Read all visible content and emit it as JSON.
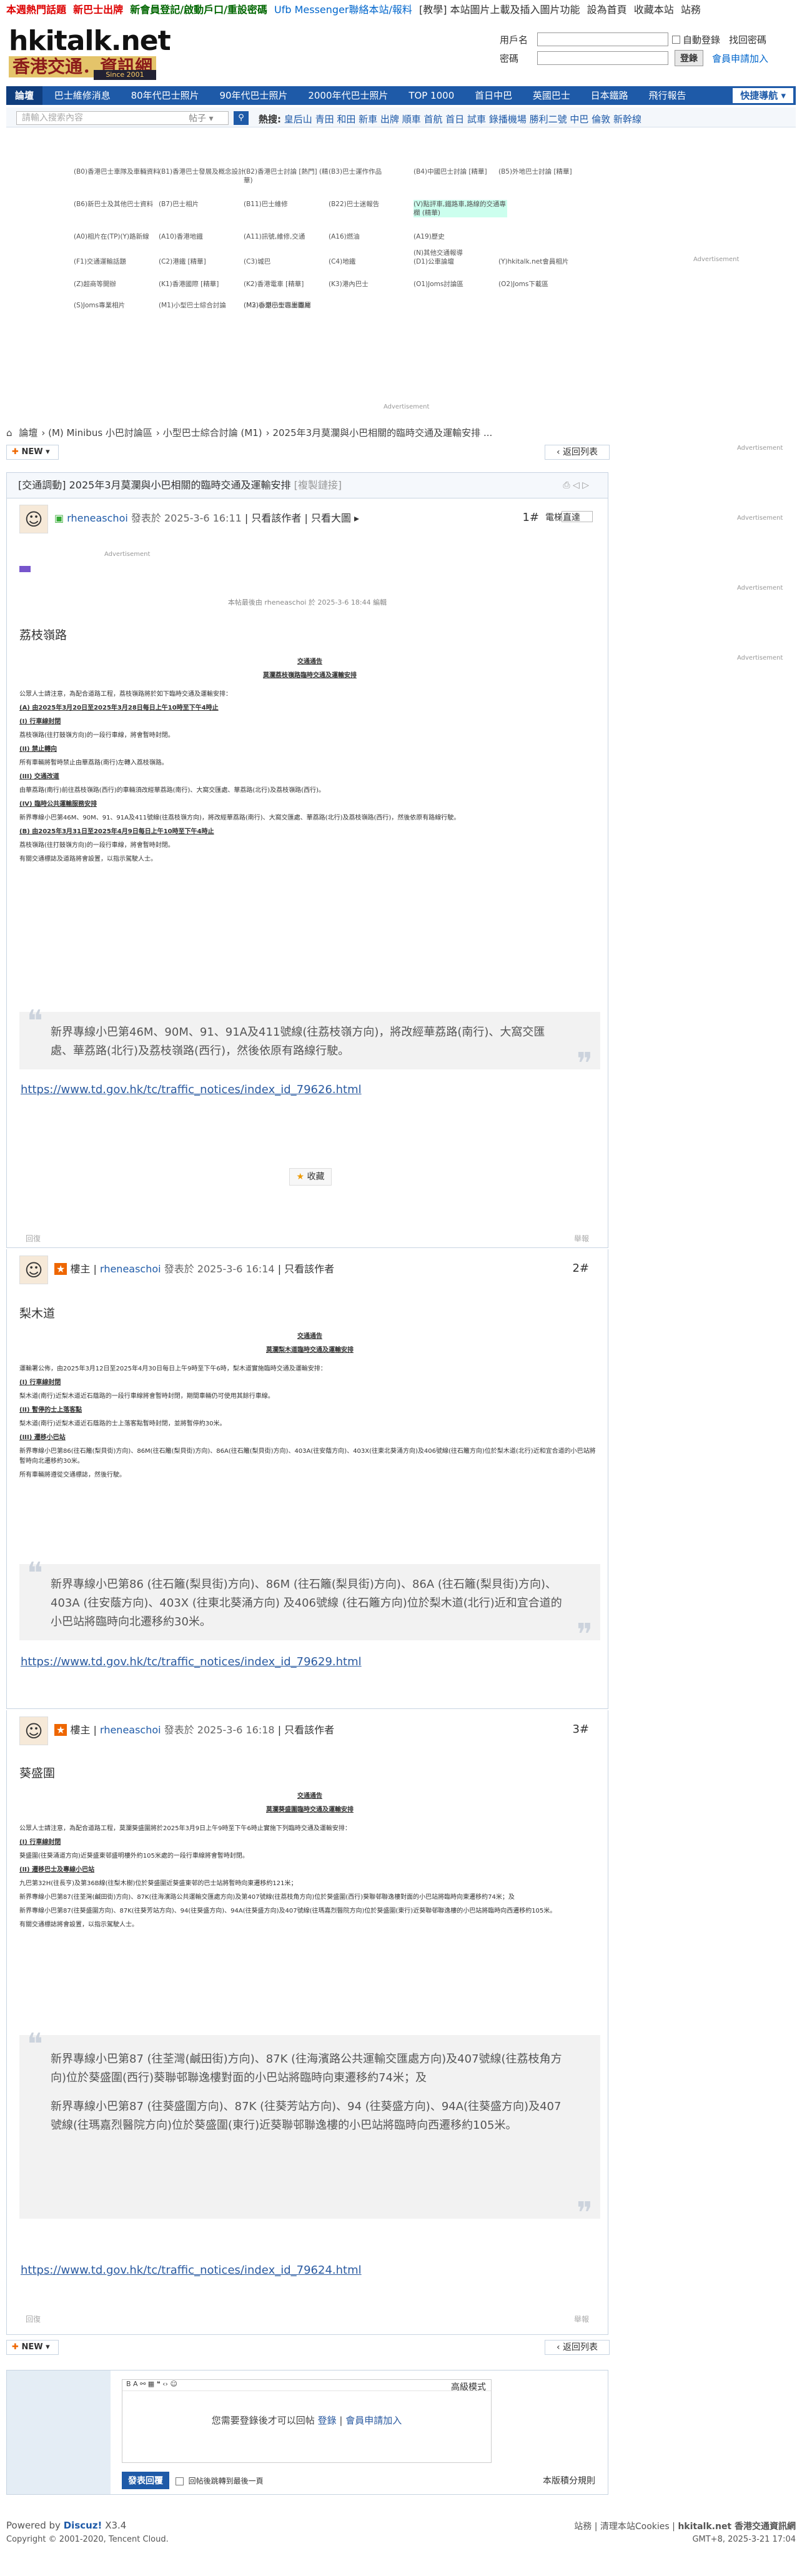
{
  "top_links": {
    "hot": "本週熱門話題",
    "new_members": "新巴士出牌",
    "signup": "新會員登記/啟動戶口/重設密碼",
    "messenger": "Ufb Messenger聯絡本站/報料",
    "teach": "[教學] 本站圖片上載及插入圖片功能",
    "home": "設為首頁",
    "fav": "收藏本站",
    "site": "站務"
  },
  "logo": {
    "site": "hkitalk.net",
    "name": "香港交通．資訊網",
    "since": "Since 2001"
  },
  "login": {
    "user_label": "用戶名",
    "pass_label": "密碼",
    "auto_login": "自動登錄",
    "forgot": "找回密碼",
    "login_btn": "登錄",
    "register": "會員申請加入"
  },
  "nav": {
    "items": [
      "論壇",
      "巴士維修消息",
      "80年代巴士照片",
      "90年代巴士照片",
      "2000年代巴士照片",
      "TOP 1000",
      "首日中巴",
      "英國巴士",
      "日本鐵路",
      "飛行報告"
    ],
    "quick": "快捷導航"
  },
  "search": {
    "placeholder": "請輸入搜索內容",
    "type": "帖子",
    "hot_label": "熱搜:",
    "hot": [
      "皇后山",
      "青田",
      "和田",
      "新車",
      "出牌",
      "順車",
      "首航",
      "首日",
      "試車",
      "錄播機場",
      "勝利二號",
      "中巴",
      "倫敦",
      "新幹線"
    ]
  },
  "forums": [
    "(B0)香港巴士車隊及車輛資料",
    "(B1)香港巴士發展及概念設計",
    "(B2)香港巴士討論 [熱門] (精華)",
    "(B3)巴士運作作品",
    "(B4)中國巴士討論 [精華]",
    "(B5)外地巴士討論 [精華]",
    "(B6)新巴士及其他巴士資料",
    "(B7)巴士相片",
    "(B11)巴士維修",
    "(B22)巴士迷報告",
    "(V)點評車,鐵路車,路線的交通專欄 (精華)",
    "(A0)相片在(TP)(Y)路新線",
    "(A10)香港地鐵",
    "(A11)訊號,維修,交通",
    "(A16)燃油",
    "(A19)歷史",
    "(N)其他交通報導",
    "(F1)交通運輸話題",
    "(C2)港鐵 [精華]",
    "(C3)城巴",
    "(C4)地鐵",
    "(D1)公車論壇",
    "(Y)hkitalk.net會員相片",
    "(Z)超商等開辦",
    "(K1)香港國際 [精華]",
    "(K2)香港電車 [精華]",
    "(K3)港內巴士",
    "(O1)Joms討論區",
    "(O2)Joms下載區",
    "(S)Joms專業相片",
    "(M1)小型巴士綜合討論",
    "(M2)小型巴士專屬圖片",
    "(M3)香港小型巴士專屬"
  ],
  "ad_label": "Advertisement",
  "breadcrumb": [
    "論壇",
    "(M) Minibus 小巴討論區",
    "小型巴士綜合討論 (M1)",
    "2025年3月莫瀾與小巴相關的臨時交通及運輸安排 ..."
  ],
  "new_btn": "NEW",
  "back_btn": "返回列表",
  "thread": {
    "tag": "[交通調動]",
    "title": "2025年3月莫瀾與小巴相關的臨時交通及運輸安排",
    "copy": "[複製鏈接]"
  },
  "posts": [
    {
      "user": "rheneaschoi",
      "time": "發表於 2025-3-6 16:11",
      "author_only": "只看該作者",
      "only_big": "只看大圖",
      "floor": "1#",
      "floor_label": "電梯直達",
      "edited": "本帖最後由 rheneaschoi 於 2025-3-6 18:44 編輯",
      "title": "荔枝嶺路",
      "doc_title": "交通通告",
      "doc_sub": "莫瀾荔枝嶺路臨時交通及運輸安排",
      "doc": [
        "公眾人士請注意，為配合道路工程，荔枝嶺路將於如下臨時交通及運輸安排：",
        "(A) 由2025年3月20日至2025年3月28日每日上午10時至下午4時止",
        "(I) 行車線封閉",
        "荔枝嶺路(往打鼓嶺方向)的一段行車線，將會暫時封閉。",
        "(II) 禁止轉向",
        "所有車輛將暫時禁止由華荔路(南行)左轉入荔枝嶺路。",
        "(III) 交通改道",
        "由華荔路(南行)前往荔枝嶺路(西行)的車輛須改經華荔路(南行)、大窩交匯處、華荔路(北行)及荔枝嶺路(西行)。",
        "(IV) 臨時公共運輸服務安排",
        "新界專線小巴第46M、90M、91、91A及411號線(往荔枝嶺方向)，將改經華荔路(南行)、大窩交匯處、華荔路(北行)及荔枝嶺路(西行)，然後依原有路線行駛。",
        "(B) 由2025年3月31日至2025年4月9日每日上午10時至下午4時止",
        "荔枝嶺路(往打鼓嶺方向)的一段行車線，將會暫時封閉。",
        "有關交通標誌及道路將會設置，以指示駕駛人士。"
      ],
      "quote": "新界專線小巴第46M、90M、91、91A及411號線(往荔枝嶺方向)，將改經華荔路(南行)、大窩交匯處、華荔路(北行)及荔枝嶺路(西行)，然後依原有路線行駛。",
      "link": "https://www.td.gov.hk/tc/traffic_notices/index_id_79626.html",
      "fav": "收藏",
      "reply": "回復",
      "top": "舉報"
    },
    {
      "role": "樓主",
      "user": "rheneaschoi",
      "time": "發表於 2025-3-6 16:14",
      "author_only": "只看該作者",
      "floor": "2#",
      "title": "梨木道",
      "doc_title": "交通通告",
      "doc_sub": "莫瀾梨木道臨時交通及運輸安排",
      "doc": [
        "運輸署公佈，由2025年3月12日至2025年4月30日每日上午9時至下午6時，梨木道實施臨時交通及運輸安排：",
        "(I) 行車線封閉",
        "梨木道(南行)近梨木道近石蔭路的一段行車線將會暫時封閉，期間車輛仍可使用其餘行車線。",
        "(II) 暫停的士上落客點",
        "梨木道(南行)近梨木道近石蔭路的士上落客點暫時封閉，並將暫停約30米。",
        "(III) 遷移小巴站",
        "新界專線小巴第86(往石籬(梨貝街)方向)、86M(往石籬(梨貝街)方向)、86A(往石籬(梨貝街)方向)、403A(往安蔭方向)、403X(往東北葵涌方向)及406號線(往石籬方向)位於梨木道(北行)近和宜合道的小巴站將暫時向北遷移約30米。",
        "所有車輛將遵從交通標誌，然後行駛。"
      ],
      "quote": "新界專線小巴第86 (往石籬(梨貝街)方向)、86M (往石籬(梨貝街)方向)、86A (往石籬(梨貝街)方向)、403A (往安蔭方向)、403X (往東北葵涌方向) 及406號線 (往石籬方向)位於梨木道(北行)近和宜合道的小巴站將臨時向北遷移約30米。",
      "link": "https://www.td.gov.hk/tc/traffic_notices/index_id_79629.html",
      "reply": "回復",
      "top": "舉報"
    },
    {
      "role": "樓主",
      "user": "rheneaschoi",
      "time": "發表於 2025-3-6 16:18",
      "author_only": "只看該作者",
      "floor": "3#",
      "title": "葵盛圍",
      "doc_title": "交通通告",
      "doc_sub": "莫瀾葵盛圍臨時交通及運輸安排",
      "doc": [
        "公眾人士請注意，為配合道路工程，莫瀾葵盛圍將於2025年3月9日上午9時至下午6時止實施下列臨時交通及運輸安排：",
        "(I) 行車線封閉",
        "葵盛圍(往葵涌道方向)近葵盛東邨盛明樓外約105米處的一段行車線將會暫時封閉。",
        "(II) 遷移巴士及專線小巴站",
        "九巴第32H(往長亨)及第36B線(往梨木樹)位於葵盛圍近葵盛東邨的巴士站將暫時向東遷移約121米；",
        "新界專線小巴第87(往荃灣(鹹田街)方向)、87K(往海濱路公共運輸交匯處方向)及第407號線(往荔枝角方向)位於葵盛圍(西行)葵聯邨聯逸樓對面的小巴站將臨時向東遷移約74米；及",
        "新界專線小巴第87(往葵盛圍方向)、87K(往葵芳站方向)、94(往葵盛方向)、94A(往葵盛方向)及407號線(往瑪嘉烈醫院方向)位於葵盛圍(東行)近葵聯邨聯逸樓的小巴站將臨時向西遷移約105米。",
        "有關交通標誌將會設置，以指示駕駛人士。"
      ],
      "quote1": "新界專線小巴第87 (往荃灣(鹹田街)方向)、87K (往海濱路公共運輸交匯處方向)及407號線(往荔枝角方向)位於葵盛圍(西行)葵聯邨聯逸樓對面的小巴站將臨時向東遷移約74米；及",
      "quote2": "新界專線小巴第87 (往葵盛圍方向)、87K (往葵芳站方向)、94 (往葵盛方向)、94A(往葵盛方向)及407號線(往瑪嘉烈醫院方向)位於葵盛圍(東行)近葵聯邨聯逸樓的小巴站將臨時向西遷移約105米。",
      "link": "https://www.td.gov.hk/tc/traffic_notices/index_id_79624.html",
      "reply": "回復",
      "top": "舉報"
    }
  ],
  "editor": {
    "advanced": "高級模式",
    "need_login": "您需要登錄後才可以回帖",
    "login": "登錄",
    "register": "會員申請加入",
    "submit": "發表回覆",
    "jump": "回帖後跳轉到最後一頁",
    "rule": "本版積分規則"
  },
  "footer": {
    "powered": "Powered by",
    "discuz": "Discuz!",
    "ver": "X3.4",
    "copy": "Copyright © 2001-2020, Tencent Cloud.",
    "links": [
      "站務",
      "清理本站Cookies",
      "hkitalk.net 香港交通資訊網"
    ],
    "time": "GMT+8, 2025-3-21 17:04"
  }
}
